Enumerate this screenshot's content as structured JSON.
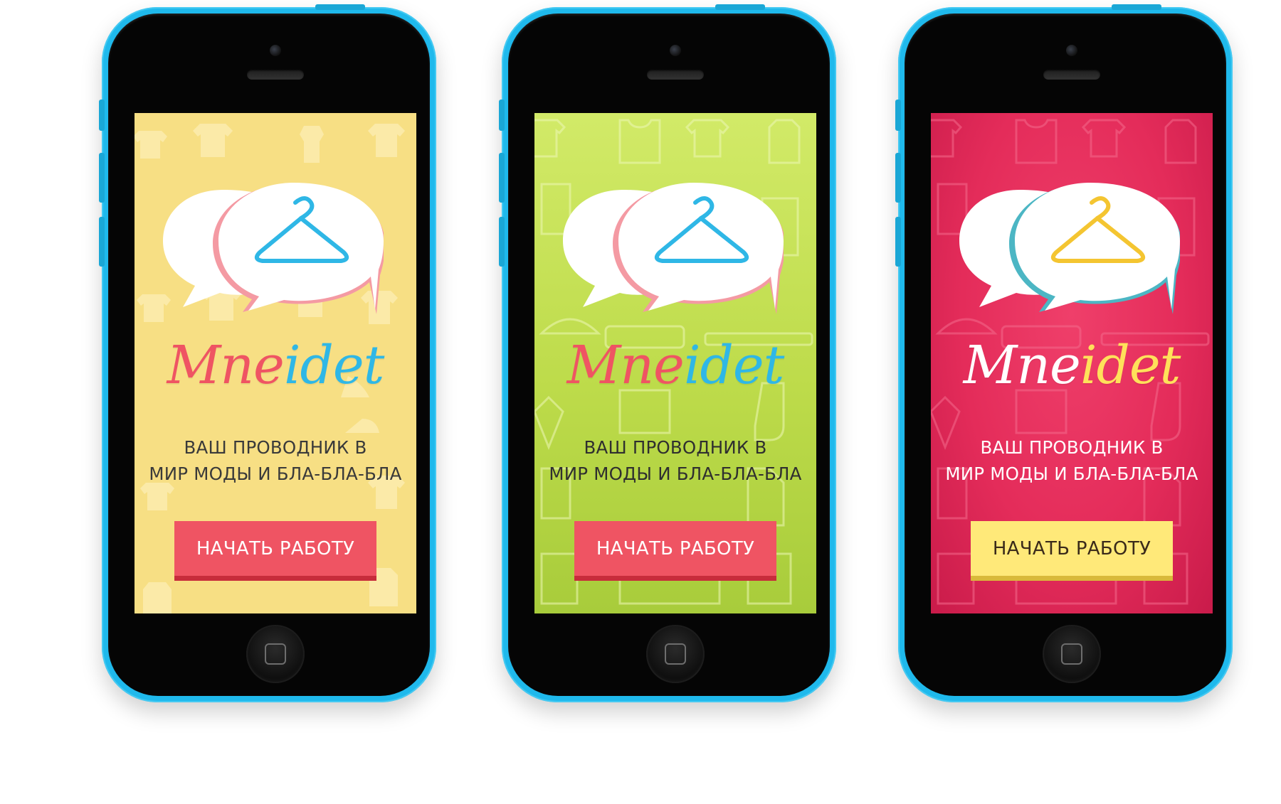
{
  "phones": [
    {
      "id": "yellow",
      "theme": {
        "background": "#f7df84",
        "pattern": "#fff4c6",
        "button_bg": "#ef5463",
        "button_text": "#ffffff",
        "tagline_color": "#3a3a3a",
        "logo_part1_color": "#ef5463",
        "logo_part2_color": "#2fb7e6",
        "hanger_color": "#2fb7e6",
        "bubble_outline": "#f49aa3"
      },
      "logo": {
        "part1": "Mne",
        "part2": "idet"
      },
      "tagline": {
        "line1": "ВАШ ПРОВОДНИК В",
        "line2": "МИР МОДЫ И БЛА-БЛА-БЛА"
      },
      "button_label": "НАЧАТЬ РАБОТУ"
    },
    {
      "id": "green",
      "theme": {
        "background": "#c6e05a",
        "pattern": "#e9f5a8",
        "button_bg": "#ef5463",
        "button_text": "#ffffff",
        "tagline_color": "#2f2f2f",
        "logo_part1_color": "#ef5463",
        "logo_part2_color": "#2fb7e6",
        "hanger_color": "#2fb7e6",
        "bubble_outline": "#f49aa3"
      },
      "logo": {
        "part1": "Mne",
        "part2": "idet"
      },
      "tagline": {
        "line1": "ВАШ ПРОВОДНИК В",
        "line2": "МИР МОДЫ И БЛА-БЛА-БЛА"
      },
      "button_label": "НАЧАТЬ РАБОТУ"
    },
    {
      "id": "pink",
      "theme": {
        "background": "#e42c5a",
        "pattern": "#f46a8c",
        "button_bg": "#ffe979",
        "button_text": "#3a2a1a",
        "tagline_color": "#ffffff",
        "logo_part1_color": "#ffffff",
        "logo_part2_color": "#ffe15a",
        "hanger_color": "#f4c531",
        "bubble_outline": "#4cb6c4"
      },
      "logo": {
        "part1": "Mne",
        "part2": "idet"
      },
      "tagline": {
        "line1": "ВАШ ПРОВОДНИК В",
        "line2": "МИР МОДЫ И БЛА-БЛА-БЛА"
      },
      "button_label": "НАЧАТЬ РАБОТУ"
    }
  ],
  "icons": [
    "hanger-icon",
    "speech-bubble-icon",
    "home-button-icon",
    "camera-icon",
    "speaker-icon"
  ]
}
